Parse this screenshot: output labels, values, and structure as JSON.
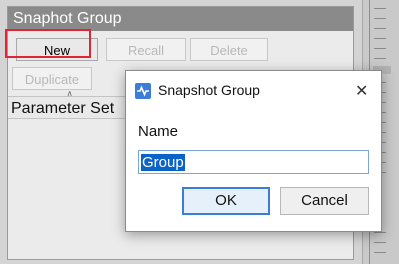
{
  "panel": {
    "title": "Snaphot Group",
    "toolbar": {
      "new_label": "New",
      "recall_label": "Recall",
      "delete_label": "Delete",
      "duplicate_label": "Duplicate"
    },
    "column_header": "Parameter Set"
  },
  "dialog": {
    "title": "Snapshot Group",
    "name_label": "Name",
    "name_value": "Group",
    "ok_label": "OK",
    "cancel_label": "Cancel"
  },
  "colors": {
    "highlight": "#e02535",
    "selection": "#0a63c8",
    "accent": "#3b7dd8"
  }
}
